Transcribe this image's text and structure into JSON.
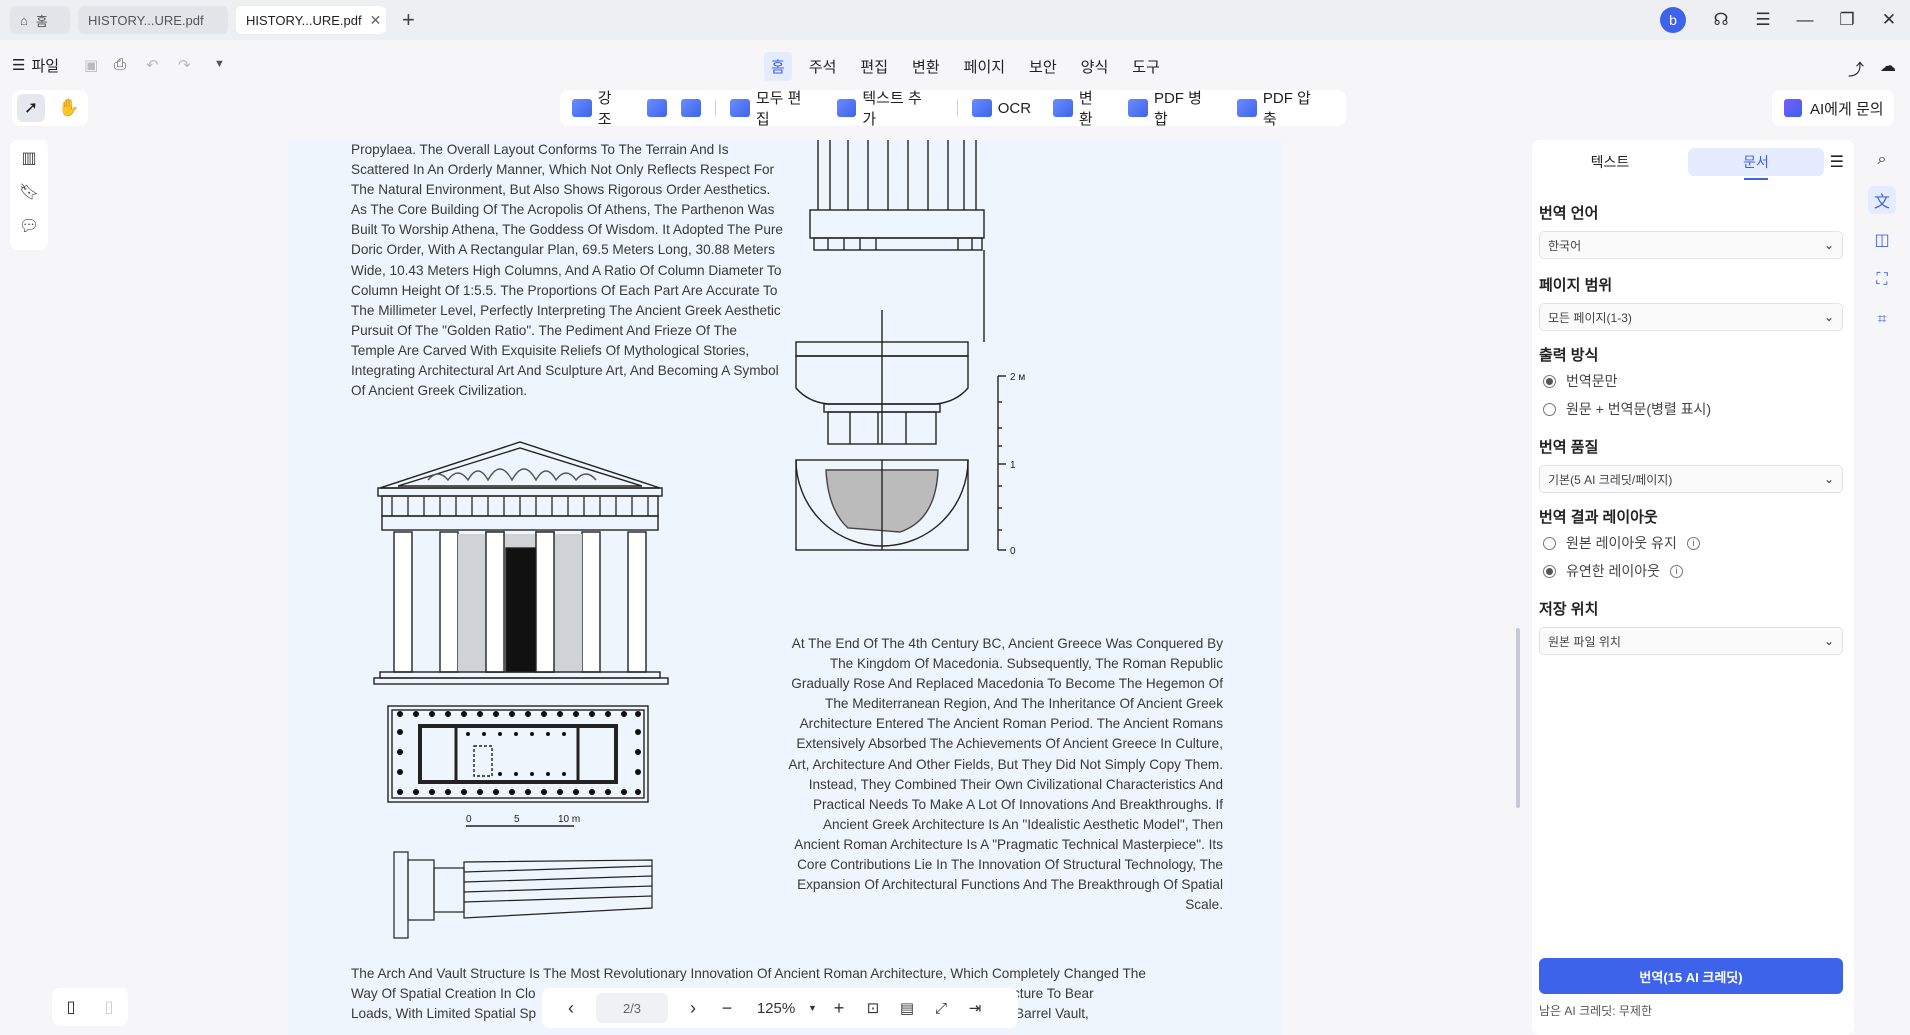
{
  "tabs": [
    {
      "label": "홈"
    },
    {
      "label": "HISTORY...URE.pdf"
    },
    {
      "label": "HISTORY...URE.pdf"
    }
  ],
  "titlebar": {
    "avatar_letter": "b"
  },
  "menubar": {
    "file_label": "파일",
    "items": [
      "홈",
      "주석",
      "편집",
      "변환",
      "페이지",
      "보안",
      "양식",
      "도구"
    ],
    "active": "홈"
  },
  "ribbon": {
    "items": [
      "강조",
      "모두 편집",
      "텍스트 추가",
      "OCR",
      "변환",
      "PDF 병합",
      "PDF 압축"
    ]
  },
  "ai_button": {
    "label": "AI에게 문의"
  },
  "document": {
    "para1": "Propylaea. The Overall Layout Conforms To The Terrain And Is Scattered In An Orderly Manner, Which Not Only Reflects Respect For The Natural Environment, But Also Shows Rigorous Order Aesthetics. As The Core Building Of The Acropolis Of Athens, The Parthenon Was Built To Worship Athena, The Goddess Of Wisdom. It Adopted The Pure Doric Order, With A Rectangular Plan, 69.5 Meters Long, 30.88 Meters Wide, 10.43 Meters High Columns, And A Ratio Of Column Diameter To Column Height Of 1:5.5. The Proportions Of Each Part Are Accurate To The Millimeter Level, Perfectly Interpreting The Ancient Greek Aesthetic Pursuit Of The \"Golden Ratio\". The Pediment And Frieze Of The Temple Are Carved With Exquisite Reliefs Of Mythological Stories, Integrating Architectural Art And Sculpture Art, And Becoming A Symbol Of Ancient Greek Civilization.",
    "para2": "At The End Of The 4th Century BC, Ancient Greece Was Conquered By The Kingdom Of Macedonia. Subsequently, The Roman Republic Gradually Rose And Replaced Macedonia To Become The Hegemon Of The Mediterranean Region, And The Inheritance Of Ancient Greek Architecture Entered The Ancient Roman Period. The Ancient Romans Extensively Absorbed The Achievements Of Ancient Greece In Culture, Art, Architecture And Other Fields, But They Did Not Simply Copy Them. Instead, They Combined Their Own Civilizational Characteristics And Practical Needs To Make A Lot Of Innovations And Breakthroughs. If Ancient Greek Architecture Is An \"Idealistic Aesthetic Model\", Then Ancient Roman Architecture Is A \"Pragmatic Technical Masterpiece\". Its Core Contributions Lie In The Innovation Of Structural Technology, The Expansion Of Architectural Functions And The Breakthrough Of Spatial Scale.",
    "para3_line1": "The Arch And Vault Structure Is The Most Revolutionary Innovation Of Ancient Roman Architecture, Which Completely Changed The",
    "para3_line2_a": "Way Of Spatial Creation In Clo",
    "para3_line2_b": "m-Column Structure To Bear",
    "para3_line3_a": "Loads, With Limited Spatial Sp",
    "para3_line3_b": "nicircular Arch, Barrel Vault,",
    "scale_labels": [
      "0",
      "5",
      "10 m"
    ],
    "column_scale": [
      "2 м",
      "1",
      "0"
    ]
  },
  "nav": {
    "page": "2/3",
    "zoom": "125%"
  },
  "panel": {
    "tab_text": "텍스트",
    "tab_doc": "문서",
    "lang_label": "번역 언어",
    "lang_value": "한국어",
    "range_label": "페이지 범위",
    "range_value": "모든 페이지(1-3)",
    "output_label": "출력 방식",
    "output_opt1": "번역문만",
    "output_opt2": "원문 + 번역문(병렬 표시)",
    "quality_label": "번역 품질",
    "quality_value": "기본(5 AI 크레딧/페이지)",
    "layout_label": "번역 결과 레이아웃",
    "layout_opt1": "원본 레이아웃 유지",
    "layout_opt2": "유연한 레이아웃",
    "save_label": "저장 위치",
    "save_value": "원본 파일 위치",
    "translate_button": "번역(15 AI 크레딧)",
    "credits_text": "남은 AI 크레딧: 무제한"
  },
  "colors": {
    "accent": "#3d63ea",
    "page_bg": "#eef5fc"
  }
}
